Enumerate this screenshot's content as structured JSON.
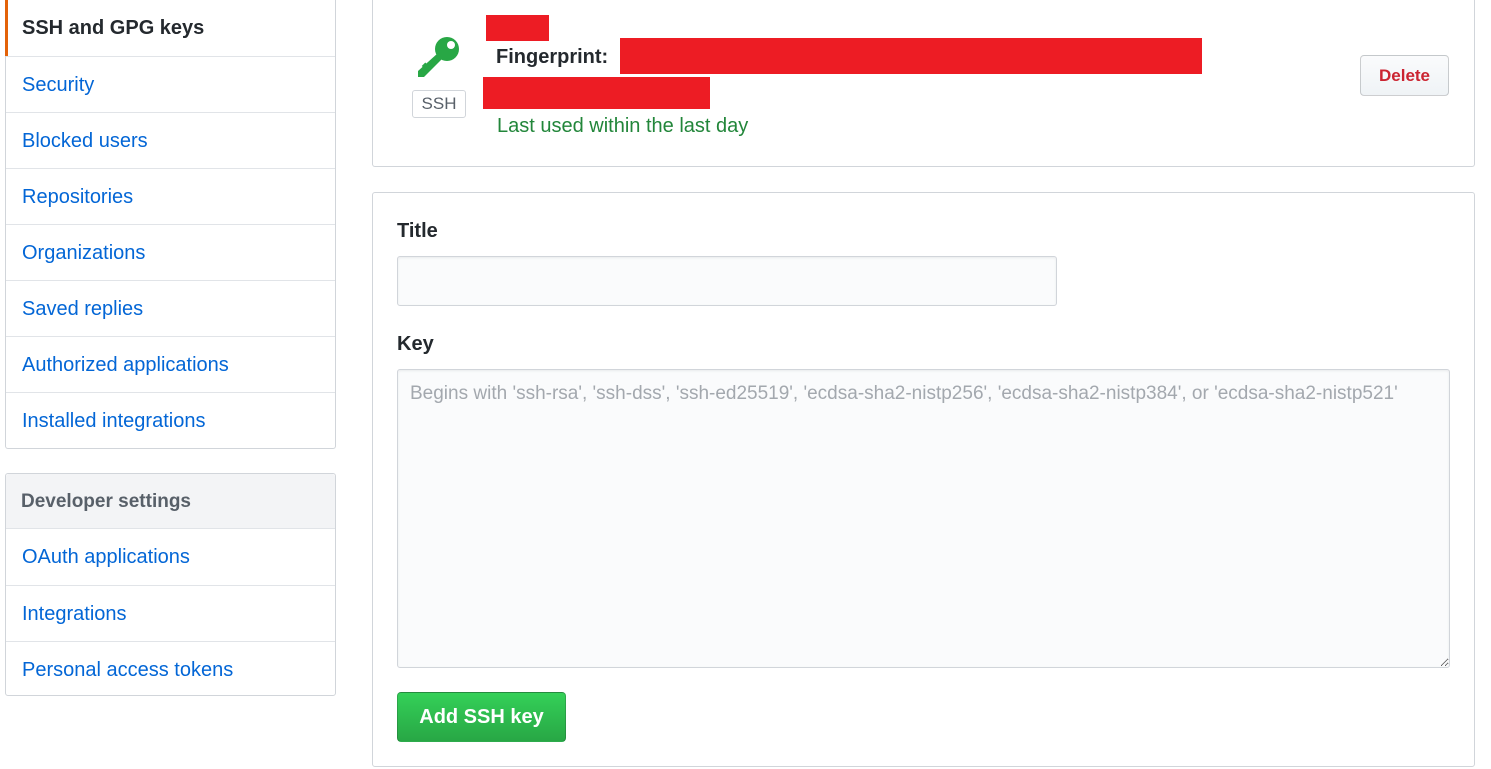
{
  "sidebar": {
    "items": [
      {
        "label": "SSH and GPG keys",
        "selected": true
      },
      {
        "label": "Security"
      },
      {
        "label": "Blocked users"
      },
      {
        "label": "Repositories"
      },
      {
        "label": "Organizations"
      },
      {
        "label": "Saved replies"
      },
      {
        "label": "Authorized applications"
      },
      {
        "label": "Installed integrations"
      }
    ],
    "developer": {
      "heading": "Developer settings",
      "items": [
        {
          "label": "OAuth applications"
        },
        {
          "label": "Integrations"
        },
        {
          "label": "Personal access tokens"
        }
      ]
    }
  },
  "ssh_key": {
    "icon": "key-icon",
    "badge": "SSH",
    "fingerprint_label": "Fingerprint:",
    "last_used": "Last used within the last day",
    "delete_label": "Delete"
  },
  "form": {
    "title_label": "Title",
    "title_value": "",
    "key_label": "Key",
    "key_placeholder": "Begins with 'ssh-rsa', 'ssh-dss', 'ssh-ed25519', 'ecdsa-sha2-nistp256', 'ecdsa-sha2-nistp384', or 'ecdsa-sha2-nistp521'",
    "submit_label": "Add SSH key"
  },
  "colors": {
    "link": "#0366d6",
    "selected_accent": "#e36209",
    "key_icon": "#28a745",
    "last_used": "#22863a",
    "delete_text": "#cb2431",
    "redaction": "#ed1c24",
    "primary_button": "#28a745"
  }
}
